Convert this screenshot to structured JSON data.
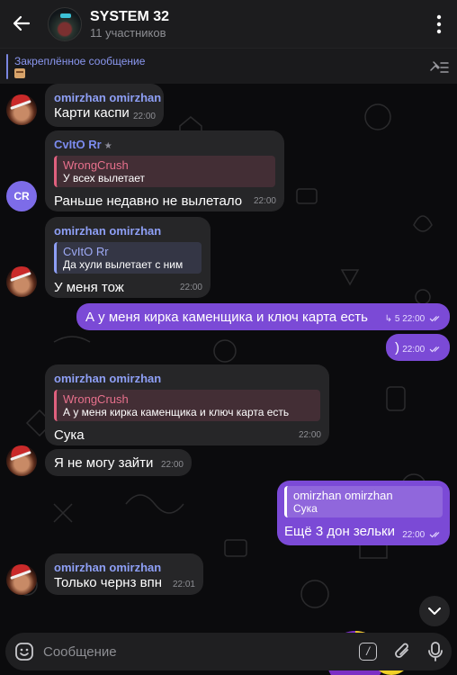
{
  "header": {
    "title": "SYSTEM 32",
    "subtitle": "11 участников"
  },
  "pinned": {
    "title": "Закреплённое сообщение"
  },
  "messages": [
    {
      "sender": "omirzhan omirzhan",
      "text": "Карти каспи",
      "time": "22:00"
    },
    {
      "sender": "CvItO Rr",
      "reply_name": "WrongCrush",
      "reply_text": "У всех вылетает",
      "text": "Раньше недавно не вылетало",
      "time": "22:00",
      "avatar": "CR"
    },
    {
      "sender": "omirzhan omirzhan",
      "reply_name": "CvItO Rr",
      "reply_text": "Да хули вылетает с ним",
      "text": "У меня тож",
      "time": "22:00"
    },
    {
      "text": "А у меня кирка каменщика и ключ карта есть",
      "views": "5",
      "time": "22:00"
    },
    {
      "text": ")",
      "time": "22:00"
    },
    {
      "sender": "omirzhan omirzhan",
      "reply_name": "WrongCrush",
      "reply_text": "А у меня кирка каменщика и ключ карта есть",
      "text": "Сука",
      "time": "22:00"
    },
    {
      "text": "Я не могу зайти",
      "time": "22:00"
    },
    {
      "reply_name": "omirzhan omirzhan",
      "reply_text": "Сука",
      "text": "Ещё 3 дон зельки",
      "time": "22:00"
    },
    {
      "sender": "omirzhan omirzhan",
      "text": "Только чернз впн",
      "time": "22:01"
    }
  ],
  "input": {
    "placeholder": "Сообщение",
    "command_label": "/"
  },
  "colors": {
    "incoming_bubble": "#262628",
    "outgoing_bubble": "#7b4ad6",
    "sender_name": "#8e9ff5",
    "reply_accent": "#e0607e",
    "cr_avatar": "#7d6ce8"
  },
  "icons": [
    "back-arrow-icon",
    "more-vertical-icon",
    "pinned-list-icon",
    "star-icon",
    "views-arrow-icon",
    "double-check-icon",
    "chevron-down-icon",
    "emoji-icon",
    "command-icon",
    "paperclip-icon",
    "microphone-icon"
  ]
}
